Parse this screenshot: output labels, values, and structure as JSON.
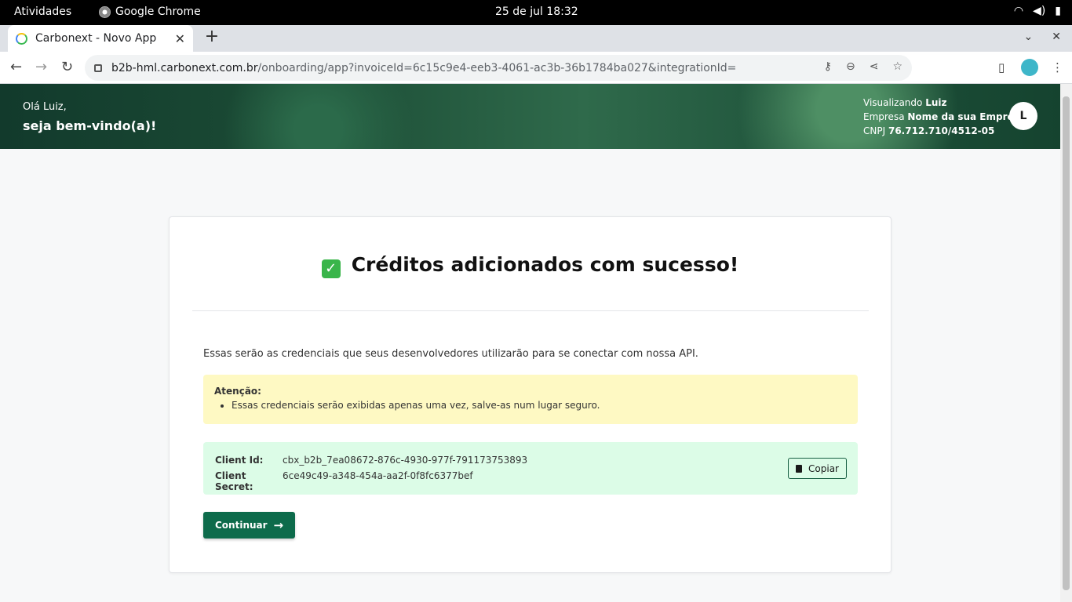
{
  "os_bar": {
    "activities": "Atividades",
    "app_name": "Google Chrome",
    "clock": "25 de jul  18:32"
  },
  "browser": {
    "tab_title": "Carbonext - Novo App",
    "url_host": "b2b-hml.carbonext.com.br",
    "url_path": "/onboarding/app?invoiceId=6c15c9e4-eeb3-4061-ac3b-36b1784ba027&integrationId="
  },
  "header": {
    "greeting": "Olá Luiz,",
    "welcome": "seja bem-vindo(a)!",
    "viewing_label": "Visualizando",
    "viewing_name": "Luiz",
    "company_label": "Empresa",
    "company_name": "Nome da sua Empresa",
    "cnpj_label": "CNPJ",
    "cnpj_value": "76.712.710/4512-05",
    "avatar_initial": "L"
  },
  "card": {
    "title": "Créditos adicionados com sucesso!",
    "check_glyph": "✓",
    "description": "Essas serão as credenciais que seus desenvolvedores utilizarão para se conectar com nossa API.",
    "alert_title": "Atenção:",
    "alert_items": [
      "Essas credenciais serão exibidas apenas uma vez, salve-as num lugar seguro."
    ],
    "client_id_label": "Client Id:",
    "client_id_value": "cbx_b2b_7ea08672-876c-4930-977f-791173753893",
    "client_secret_label": "Client Secret:",
    "client_secret_value": "6ce49c49-a348-454a-aa2f-0f8fc6377bef",
    "copy_label": "Copiar",
    "continue_label": "Continuar"
  },
  "colors": {
    "primary_green": "#0d6b4b",
    "alert_bg": "#fef9c3",
    "success_bg": "#dcfce7"
  }
}
